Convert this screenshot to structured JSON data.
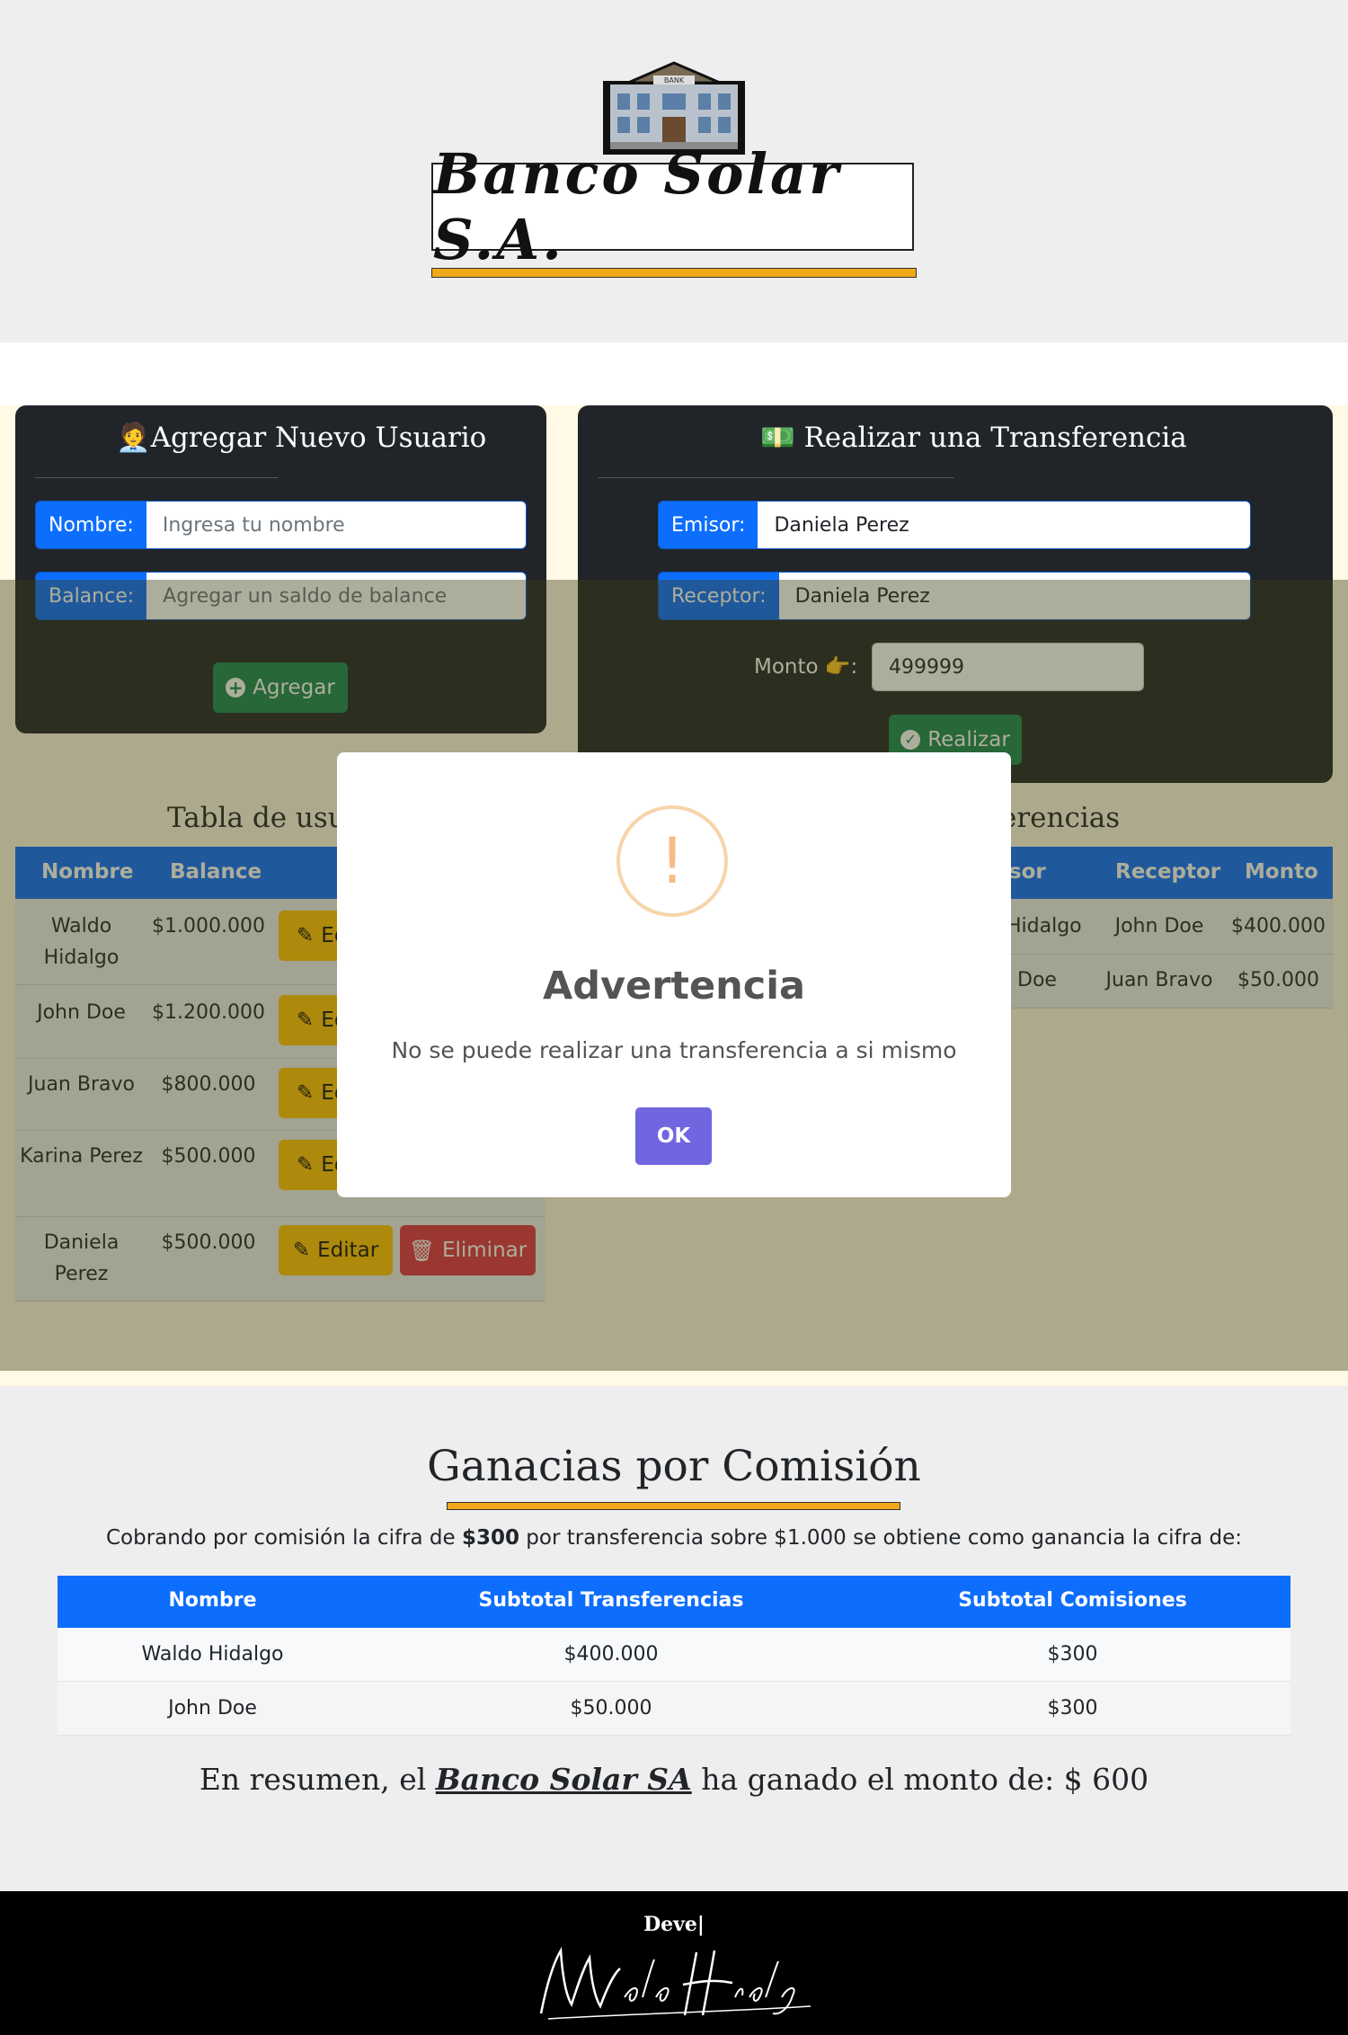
{
  "header": {
    "bank_sign": "BANK",
    "title": "Banco Solar S.A."
  },
  "new_user": {
    "title": "🧑‍💼Agregar Nuevo Usuario",
    "name_label": "Nombre:",
    "name_placeholder": "Ingresa tu nombre",
    "balance_label": "Balance:",
    "balance_placeholder": "Agregar un saldo de balance",
    "submit_label": "Agregar"
  },
  "transfer": {
    "title": "💵 Realizar una Transferencia",
    "emisor_label": "Emisor:",
    "emisor_value": "Daniela Perez",
    "receptor_label": "Receptor:",
    "receptor_value": "Daniela Perez",
    "amount_label": "Monto 👉:",
    "amount_value": "499999",
    "submit_label": "Realizar"
  },
  "users_table": {
    "title": "Tabla de usua",
    "columns": [
      "Nombre",
      "Balance"
    ],
    "rows": [
      {
        "name": "Waldo Hidalgo",
        "balance": "$1.000.000",
        "edit": "Ed"
      },
      {
        "name": "John Doe",
        "balance": "$1.200.000",
        "edit": "Ed"
      },
      {
        "name": "Juan Bravo",
        "balance": "$800.000",
        "edit": "Ed"
      },
      {
        "name": "Karina Perez",
        "balance": "$500.000",
        "edit": "Ed"
      },
      {
        "name": "Daniela Perez",
        "balance": "$500.000",
        "edit": "Editar",
        "delete": "Eliminar"
      }
    ]
  },
  "transfers_table": {
    "title": "erencias",
    "columns": [
      "isor",
      "Receptor",
      "Monto"
    ],
    "rows": [
      {
        "emisor": "Hidalgo",
        "receptor": "John Doe",
        "monto": "$400.000"
      },
      {
        "emisor": "Doe",
        "receptor": "Juan Bravo",
        "monto": "$50.000"
      }
    ]
  },
  "modal": {
    "icon": "!",
    "title": "Advertencia",
    "message": "No se puede realizar una transferencia a si mismo",
    "ok_label": "OK"
  },
  "earnings": {
    "title": "Ganacias por Comisión",
    "desc_prefix": "Cobrando por comisión la cifra de ",
    "desc_bold": "$300",
    "desc_suffix": " por transferencia sobre $1.000 se obtiene como ganancia la cifra de:",
    "columns": [
      "Nombre",
      "Subtotal Transferencias",
      "Subtotal Comisiones"
    ],
    "rows": [
      {
        "name": "Waldo Hidalgo",
        "subtotal": "$400.000",
        "commission": "$300"
      },
      {
        "name": "John Doe",
        "subtotal": "$50.000",
        "commission": "$300"
      }
    ],
    "summary_prefix": "En resumen, el ",
    "summary_brand": "Banco Solar SA",
    "summary_suffix": " ha ganado el monto de: $ 600"
  },
  "footer": {
    "label": "Deve|",
    "signature": "Waldo Hidalgo"
  },
  "colors": {
    "primary": "#0d6efd",
    "success": "#198754",
    "warning": "#ffc107",
    "danger": "#dc3545",
    "accent": "#f0a81a",
    "modal_button": "#7066e0"
  }
}
